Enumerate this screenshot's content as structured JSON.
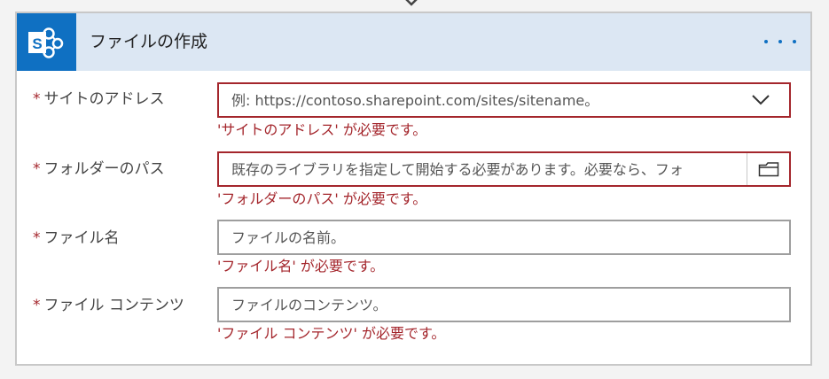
{
  "action": {
    "title": "ファイルの作成",
    "app_icon_letter": "S"
  },
  "fields": [
    {
      "label": "サイトのアドレス",
      "required_mark": "*",
      "placeholder": "例: https://contoso.sharepoint.com/sites/sitename。",
      "value": "",
      "error": "'サイトのアドレス' が必要です。"
    },
    {
      "label": "フォルダーのパス",
      "required_mark": "*",
      "placeholder": "既存のライブラリを指定して開始する必要があります。必要なら、フォ",
      "value": "",
      "error": "'フォルダーのパス' が必要です。"
    },
    {
      "label": "ファイル名",
      "required_mark": "*",
      "placeholder": "ファイルの名前。",
      "value": "",
      "error": "'ファイル名' が必要です。"
    },
    {
      "label": "ファイル コンテンツ",
      "required_mark": "*",
      "placeholder": "ファイルのコンテンツ。",
      "value": "",
      "error": "'ファイル コンテンツ' が必要です。"
    }
  ],
  "colors": {
    "brand": "#0f70c2",
    "header_bg": "#dce7f3",
    "error": "#a4262c"
  },
  "icons": {
    "app": "sharepoint-icon",
    "more": "ellipsis-icon",
    "dropdown": "chevron-down-icon",
    "picker": "folder-icon",
    "connector": "arrow-down-icon"
  }
}
